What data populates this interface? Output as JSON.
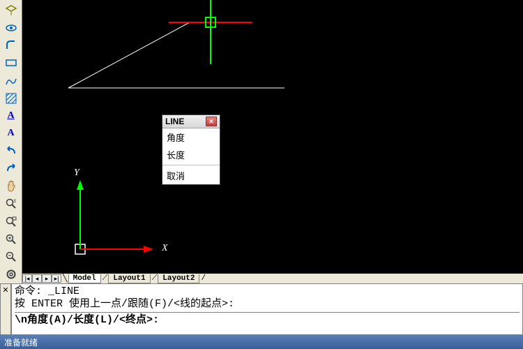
{
  "toolbar_icons": [
    "attribute",
    "eye",
    "fillet",
    "rectangle",
    "sketch",
    "hatch",
    "text-a",
    "text-aa",
    "undo",
    "redo",
    "pan",
    "zoom-realtime",
    "zoom-window",
    "zoom-in",
    "zoom-out",
    "zoom-extents"
  ],
  "ucs": {
    "x_label": "X",
    "y_label": "Y"
  },
  "popup": {
    "title": "LINE",
    "items": [
      "角度",
      "长度"
    ],
    "cancel": "取消"
  },
  "tabs": {
    "model": "Model",
    "layout1": "Layout1",
    "layout2": "Layout2"
  },
  "command": {
    "line1": "命令: _LINE",
    "line2": "按 ENTER 使用上一点/跟随(F)/<线的起点>:",
    "line3": "\\n角度(A)/长度(L)/<终点>:"
  },
  "status": "准备就绪"
}
